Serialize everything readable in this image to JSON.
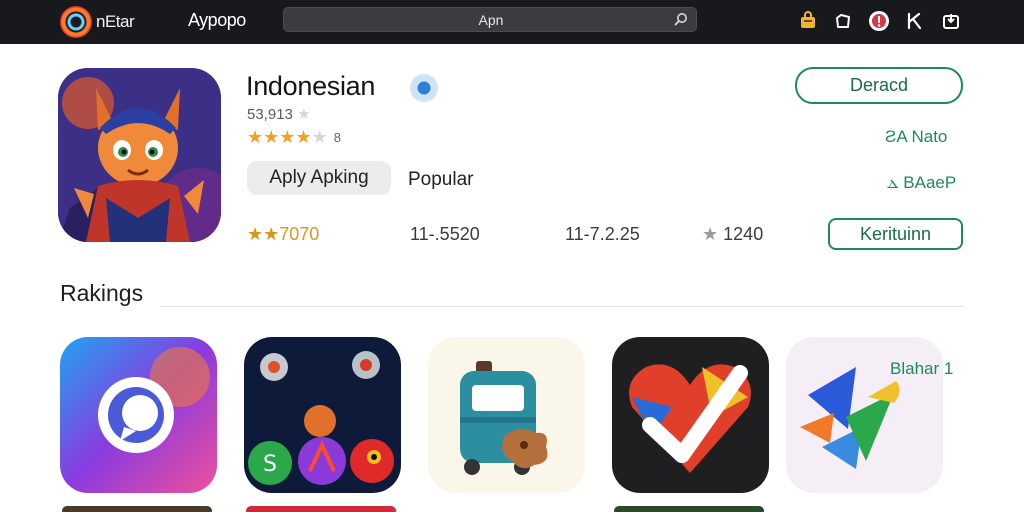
{
  "topbar": {
    "brand_name": "nEtar",
    "nav_link": "Aypopo",
    "search": {
      "value": "Apn",
      "icon": "search-icon"
    },
    "icons": [
      "bag-icon",
      "camera-icon",
      "notification-icon",
      "user-icon",
      "download-icon"
    ]
  },
  "app": {
    "title": "Indonesian",
    "badge_icon": "verified-icon",
    "subtitle": "53,913",
    "rating_stars": 4,
    "rating_max": 5,
    "rating_count": "8",
    "chip_label": "Aply Apking",
    "tag_label": "Popular",
    "stats": {
      "rating": "★★7070",
      "downloads": "11-.5520",
      "size": "11-7.2.25",
      "reviews": "1240"
    },
    "download_button": "Deracd",
    "link_1": "ƧA Nato",
    "link_2": "ⲇ BAaeP",
    "more_button": "Kerituinn"
  },
  "rankings": {
    "title": "Rakings",
    "side_label": "Blahar 1",
    "items": [
      {
        "name": "chat-app-icon"
      },
      {
        "name": "planets-game-icon"
      },
      {
        "name": "luggage-app-icon"
      },
      {
        "name": "heart-check-app-icon"
      },
      {
        "name": "feather-app-icon"
      }
    ]
  },
  "colors": {
    "topbar": "#17191c",
    "accent_green": "#1e8a5a",
    "star": "#f3a21c"
  }
}
